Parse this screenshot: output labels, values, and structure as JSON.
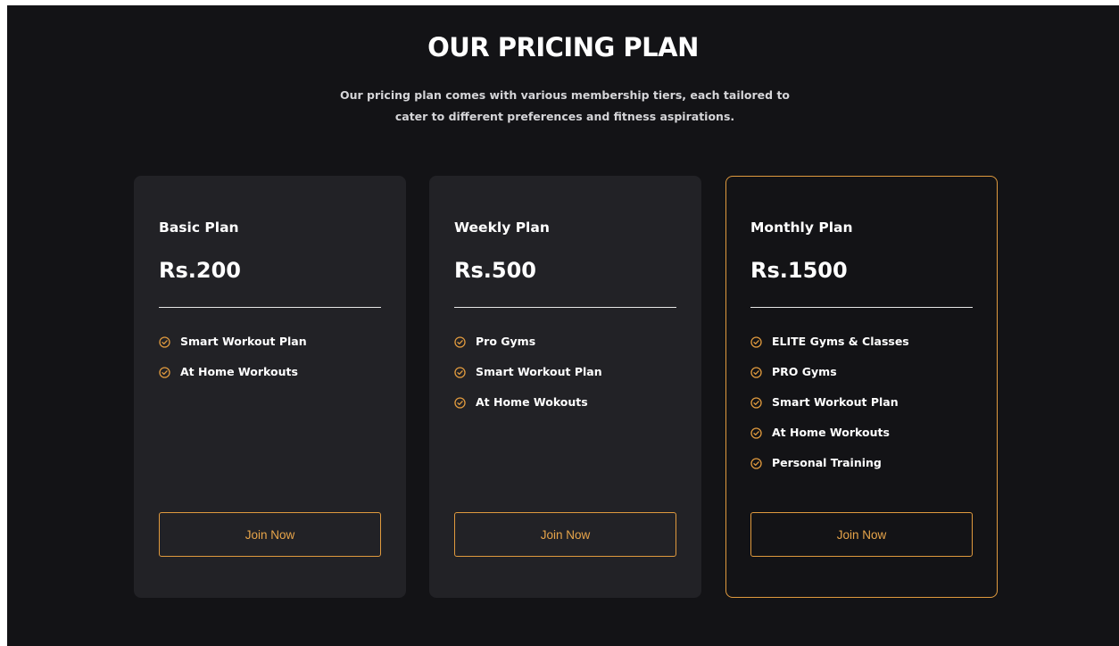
{
  "section": {
    "title": "OUR PRICING PLAN",
    "subtitle": "Our pricing plan comes with various membership tiers, each tailored to cater to different preferences and fitness aspirations."
  },
  "colors": {
    "background": "#131316",
    "card": "#222226",
    "accent": "#e09a3e",
    "text": "#ffffff"
  },
  "plans": [
    {
      "name": "Basic Plan",
      "price": "Rs.200",
      "features": [
        "Smart Workout Plan",
        "At Home Workouts"
      ],
      "cta": "Join Now"
    },
    {
      "name": "Weekly Plan",
      "price": "Rs.500",
      "features": [
        "Pro Gyms",
        "Smart Workout Plan",
        "At Home Wokouts"
      ],
      "cta": "Join Now"
    },
    {
      "name": "Monthly Plan",
      "price": "Rs.1500",
      "highlighted": true,
      "features": [
        "ELITE Gyms & Classes",
        "PRO Gyms",
        "Smart Workout Plan",
        "At Home Workouts",
        "Personal Training"
      ],
      "cta": "Join Now"
    }
  ],
  "icons": {
    "feature": "check-circle-icon"
  }
}
